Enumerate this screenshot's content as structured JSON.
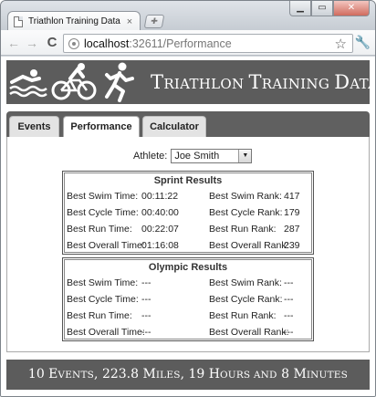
{
  "browser": {
    "tab_title": "Triathlon Training Data",
    "tab_close": "×",
    "url_host": "localhost",
    "url_path": ":32611/Performance"
  },
  "banner": {
    "title_caps": [
      "T",
      "RIATHLON ",
      "T",
      "RAINING ",
      "D",
      "ATA"
    ]
  },
  "tabs": [
    {
      "label": "Events",
      "active": false
    },
    {
      "label": "Performance",
      "active": true
    },
    {
      "label": "Calculator",
      "active": false
    }
  ],
  "athlete": {
    "label": "Athlete:",
    "selected": "Joe Smith"
  },
  "sprint": {
    "title": "Sprint Results",
    "rows": [
      {
        "l1": "Best Swim Time:",
        "v1": "00:11:22",
        "l2": "Best Swim Rank:",
        "v2": "417"
      },
      {
        "l1": "Best Cycle Time:",
        "v1": "00:40:00",
        "l2": "Best Cycle Rank:",
        "v2": "179"
      },
      {
        "l1": "Best Run Time:",
        "v1": "00:22:07",
        "l2": "Best Run Rank:",
        "v2": "287"
      },
      {
        "l1": "Best Overall Time:",
        "v1": "01:16:08",
        "l2": "Best Overall Rank:",
        "v2": "239"
      }
    ]
  },
  "olympic": {
    "title": "Olympic Results",
    "rows": [
      {
        "l1": "Best Swim Time:",
        "v1": "---",
        "l2": "Best Swim Rank:",
        "v2": "---"
      },
      {
        "l1": "Best Cycle Time:",
        "v1": "---",
        "l2": "Best Cycle Rank:",
        "v2": "---"
      },
      {
        "l1": "Best Run Time:",
        "v1": "---",
        "l2": "Best Run Rank:",
        "v2": "---"
      },
      {
        "l1": "Best Overall Time:",
        "v1": "---",
        "l2": "Best Overall Rank:",
        "v2": "---"
      }
    ]
  },
  "footer": {
    "parts": [
      {
        "text": "10 E",
        "size": "big"
      },
      {
        "text": "VENTS",
        "size": "small"
      },
      {
        "text": ", 223.8 M",
        "size": "big"
      },
      {
        "text": "ILES",
        "size": "small"
      },
      {
        "text": ", 19 H",
        "size": "big"
      },
      {
        "text": "OURS AND",
        "size": "small"
      },
      {
        "text": " 8 M",
        "size": "big"
      },
      {
        "text": "INUTES",
        "size": "small"
      }
    ]
  },
  "colors": {
    "banner_bg": "#5c5c5c",
    "tabstrip_bg": "#606060"
  }
}
